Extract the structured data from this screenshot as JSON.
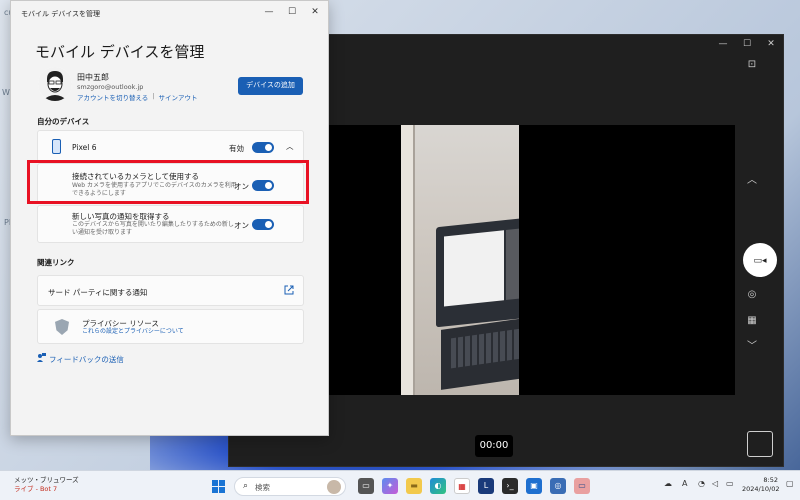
{
  "desktop": {
    "frag1": "W",
    "frag2": "cu",
    "frag3": "PM"
  },
  "camera": {
    "timer": "00:00",
    "controls": {
      "minimize": "—",
      "maximize": "☐",
      "close": "✕"
    },
    "side_icons": {
      "settings": "⊡",
      "chevron_up": "︿",
      "video": "▭◂",
      "photo": "◎",
      "qr": "▦",
      "chevron_down": "﹀"
    }
  },
  "settings": {
    "window_title": "モバイル デバイスを管理",
    "page_title": "モバイル デバイスを管理",
    "user": {
      "name": "田中五郎",
      "email": "smzgoro@outlook.jp",
      "switch_account": "アカウントを切り替える",
      "separator": "|",
      "sign_out": "サインアウト"
    },
    "add_device": "デバイスの追加",
    "my_devices_label": "自分のデバイス",
    "device": {
      "name": "Pixel 6",
      "status": "有効",
      "chevron": "︿"
    },
    "camera_option": {
      "title": "接続されているカメラとして使用する",
      "desc1": "Web カメラを使用するアプリでこのデバイスのカメラを利用",
      "desc2": "できるようにします",
      "state": "オン"
    },
    "photo_option": {
      "title": "新しい写真の通知を取得する",
      "desc1": "このデバイスから写真を開いたり編集したりするための新し",
      "desc2": "い通知を受け取ります",
      "state": "オン"
    },
    "related_links_label": "関連リンク",
    "third_party": "サード パーティに関する通知",
    "privacy": {
      "title": "プライバシー リソース",
      "link": "これらの設定とプライバシーについて"
    },
    "feedback": "フィードバックの送信"
  },
  "taskbar": {
    "news_line1": "メッツ・ブリュワーズ",
    "news_line2": "ライブ - Bot 7",
    "search_placeholder": "検索",
    "tray_lang": "A",
    "time": "8:52",
    "date": "2024/10/02"
  }
}
